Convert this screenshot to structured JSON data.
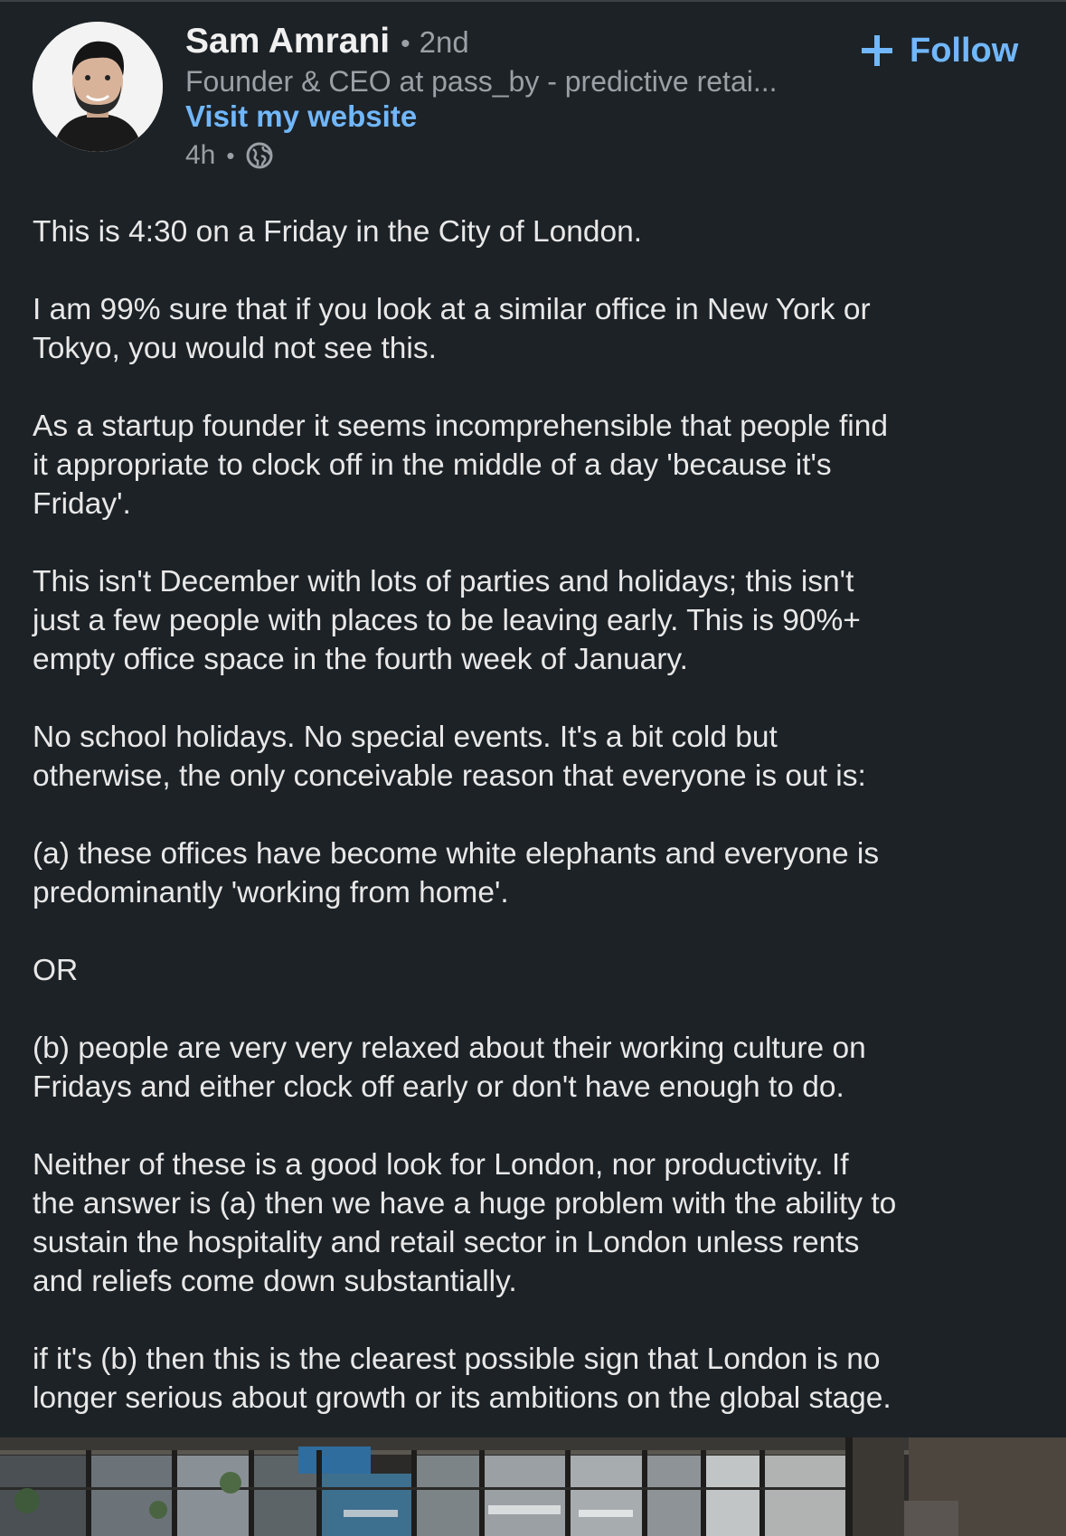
{
  "author": {
    "name": "Sam Amrani",
    "separator": "•",
    "degree": "2nd",
    "headline": "Founder & CEO at pass_by - predictive retai...",
    "website_link": "Visit my website",
    "time": "4h",
    "visibility_icon": "globe-icon"
  },
  "follow": {
    "label": "Follow",
    "icon": "plus-icon"
  },
  "post": {
    "paragraphs": [
      "This is 4:30 on a Friday in the City of London.",
      "I am 99% sure that if you look at a similar office in New York or\nTokyo, you would not see this.",
      "As a startup founder it seems incomprehensible that people find\nit appropriate to clock off in the middle of a day 'because it's\nFriday'.",
      "This isn't December with lots of parties and holidays;  this isn't\njust a few people with places to be leaving early. This is 90%+\nempty office space in the fourth week of January.",
      "No school holidays. No special events. It's a bit cold but\notherwise, the only conceivable reason that everyone is out is:",
      "(a) these offices have become white elephants and everyone is\npredominantly 'working from home'.",
      "OR",
      "(b) people are very very relaxed about their working culture on\nFridays and either clock off early or don't have enough to do.",
      "Neither of these is a good look for London, nor productivity. If\nthe answer is (a) then we have a huge problem with the ability to\nsustain the hospitality and retail sector in London unless rents\nand reliefs come down substantially.",
      "if it's (b) then this is the clearest possible sign that London is no\nlonger serious about growth or its ambitions on the global stage."
    ]
  },
  "colors": {
    "background": "#1d2226",
    "text": "#e8e8e8",
    "muted": "#9aa0a6",
    "link": "#71b7fb"
  }
}
